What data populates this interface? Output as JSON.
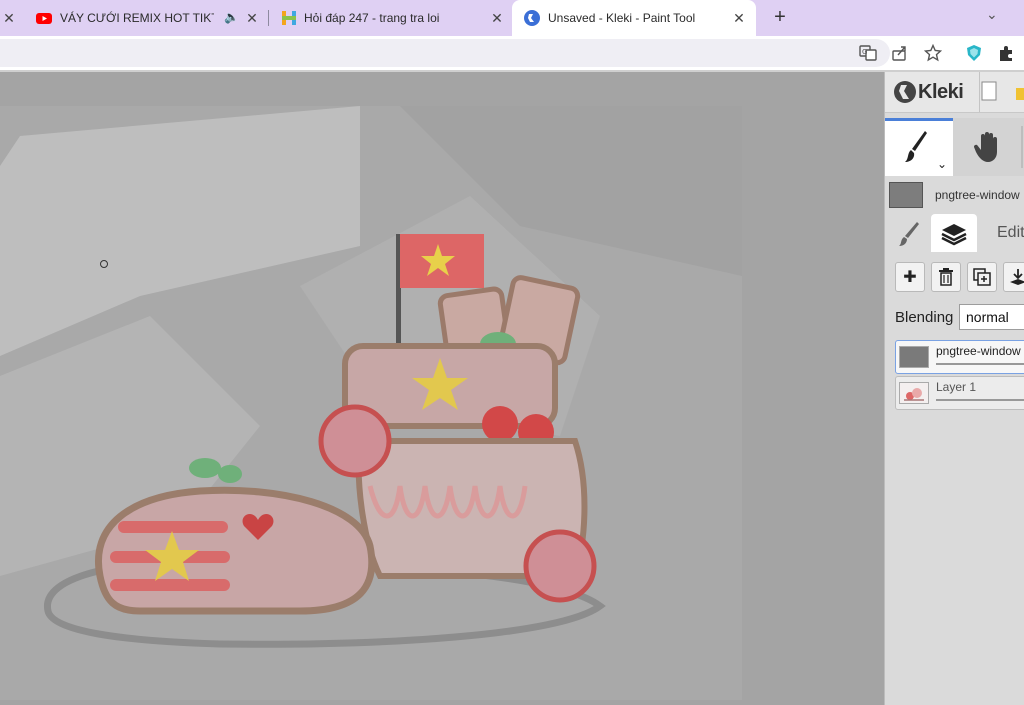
{
  "browser": {
    "tabs": [
      {
        "title": "VÁY CƯỚI REMIX HOT TIKTOK",
        "favicon": "youtube-icon",
        "audio": true,
        "active": false
      },
      {
        "title": "Hỏi đáp 247 - trang tra loi",
        "favicon": "hoidap-icon",
        "audio": false,
        "active": false
      },
      {
        "title": "Unsaved - Kleki - Paint Tool",
        "favicon": "kleki-icon",
        "audio": false,
        "active": true
      }
    ],
    "new_tab_label": "+",
    "tab_menu_glyph": "⌄",
    "toolbar_icons": [
      "translate-icon",
      "share-icon",
      "bookmark-star-icon",
      "extension-shield-icon",
      "extensions-puzzle-icon"
    ]
  },
  "kleki": {
    "brand": "Kleki",
    "image_layer_label": "pngtree-window",
    "subtab_edit": "Edit",
    "blending_label": "Blending",
    "blending_value": "normal",
    "layers": [
      {
        "name": "pngtree-window",
        "selected": true
      },
      {
        "name": "Layer 1",
        "selected": false
      }
    ]
  },
  "colors": {
    "tab_strip": "#dfd0f3",
    "accent_blue": "#4a7fd8",
    "workspace": "#a4a4a4"
  }
}
